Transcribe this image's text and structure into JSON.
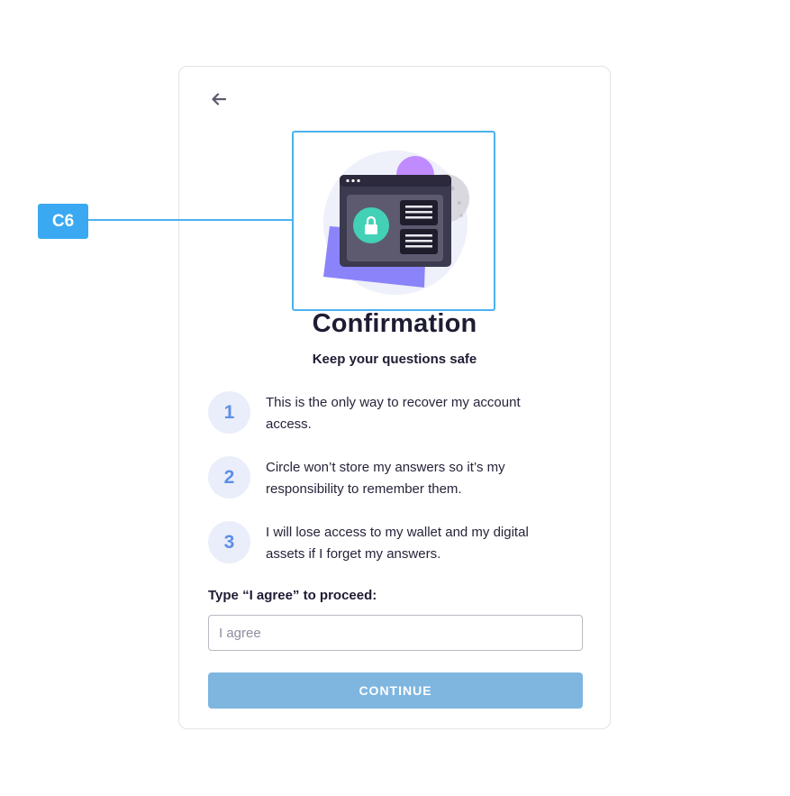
{
  "annotation": {
    "tag": "C6"
  },
  "header": {
    "back_icon": "arrow-left-icon"
  },
  "illustration": {
    "icon": "lock-icon"
  },
  "content": {
    "title": "Confirmation",
    "subtitle": "Keep your questions safe",
    "steps": [
      {
        "number": "1",
        "text": "This is the only way to recover my account access."
      },
      {
        "number": "2",
        "text": "Circle won’t store my answers so it’s my responsibility to remember them."
      },
      {
        "number": "3",
        "text": "I will lose access to my wallet and my digital assets if I forget my answers."
      }
    ]
  },
  "form": {
    "prompt": "Type “I agree” to proceed:",
    "input_value": "",
    "input_placeholder": "I agree",
    "continue_label": "CONTINUE"
  },
  "colors": {
    "accent": "#3aa9f1",
    "button_disabled": "#7fb6e0",
    "step_number": "#5d8fe6",
    "lock": "#42d1b6"
  }
}
